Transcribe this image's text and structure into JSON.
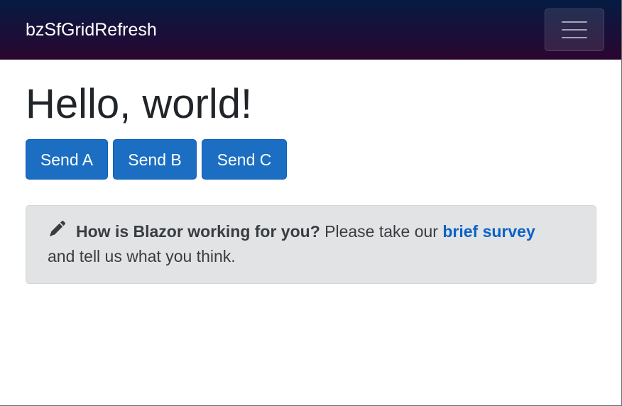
{
  "navbar": {
    "brand": "bzSfGridRefresh",
    "menu_icon": "hamburger-menu-icon"
  },
  "main": {
    "heading": "Hello, world!",
    "buttons": [
      {
        "label": "Send A"
      },
      {
        "label": "Send B"
      },
      {
        "label": "Send C"
      }
    ]
  },
  "survey": {
    "icon": "pencil-icon",
    "question": "How is Blazor working for you?",
    "before_link": "Please take our",
    "link_text": "brief survey",
    "after_link": "and tell us what you think."
  },
  "colors": {
    "navbar_start": "#051b42",
    "navbar_end": "#2a0630",
    "button_primary": "#1b6ec2",
    "alert_background": "#e2e3e5",
    "link": "#0b62c6"
  }
}
